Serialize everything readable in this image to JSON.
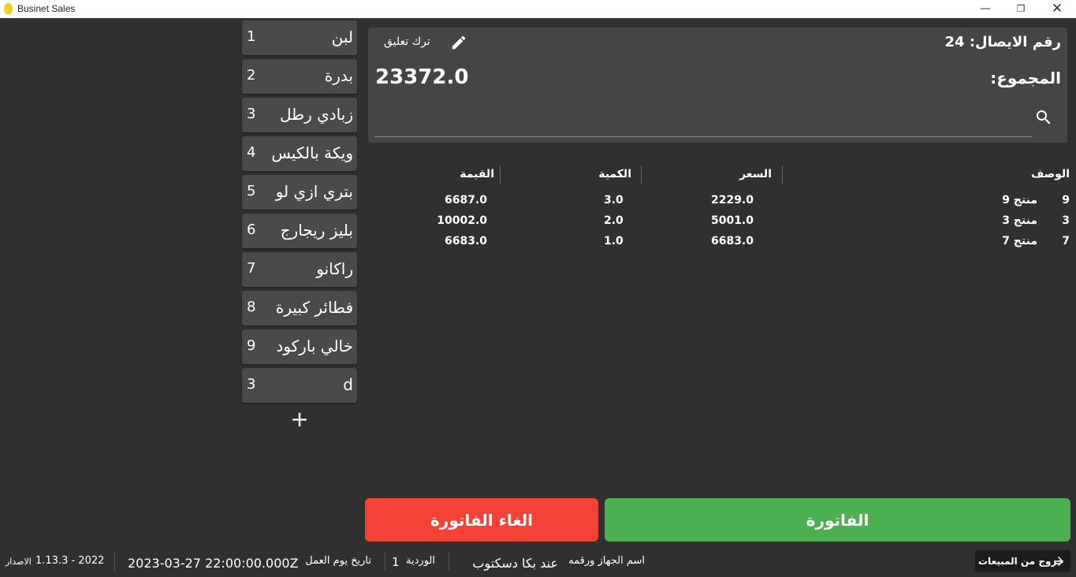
{
  "window": {
    "title": "Businet Sales"
  },
  "products": [
    {
      "name": "لبن",
      "number": "1"
    },
    {
      "name": "بدرة",
      "number": "2"
    },
    {
      "name": "زبادي رطل",
      "number": "3"
    },
    {
      "name": "ويكة بالكيس",
      "number": "4"
    },
    {
      "name": "بتري ازي لو",
      "number": "5"
    },
    {
      "name": "بليز ريجارج",
      "number": "6"
    },
    {
      "name": "راكانو",
      "number": "7"
    },
    {
      "name": "فطائر كبيرة",
      "number": "8"
    },
    {
      "name": "خالي باركود",
      "number": "9"
    },
    {
      "name": "d",
      "number": "3"
    }
  ],
  "add_product_symbol": "+",
  "header": {
    "receipt_number": "رقم الايصال: 24",
    "comment_label": "ترك تعليق",
    "total_label": "المجموع:",
    "total_value": "23372.0",
    "search_placeholder": ""
  },
  "table": {
    "headers": {
      "description": "الوصف",
      "price": "السعر",
      "quantity": "الكمية",
      "value": "القيمة"
    },
    "rows": [
      {
        "id": "9",
        "description": "منتج 9",
        "price": "2229.0",
        "quantity": "3.0",
        "value": "6687.0"
      },
      {
        "id": "3",
        "description": "منتج 3",
        "price": "5001.0",
        "quantity": "2.0",
        "value": "10002.0"
      },
      {
        "id": "7",
        "description": "منتج 7",
        "price": "6683.0",
        "quantity": "1.0",
        "value": "6683.0"
      }
    ]
  },
  "actions": {
    "invoice": "الفاتورة",
    "cancel_invoice": "الغاء الفاتورة"
  },
  "status": {
    "exit_label": "خروج من المبيعات",
    "device_label": "اسم الجهاز ورقمه",
    "device_value": "عند بكا دسكتوب",
    "shift_label": "الوردية",
    "shift_value": "1",
    "workday_label": "تاريخ يوم العمل",
    "workday_value": "2023-03-27 22:00:00.000Z",
    "version_label": "الاصدار",
    "version_value": "1.13.3 - 2022"
  },
  "colors": {
    "background": "#303030",
    "panel": "#454545",
    "product_button": "#4a4a4a",
    "invoice_green": "#4caf50",
    "cancel_red": "#f44336",
    "logo_yellow": "#f2d21b"
  }
}
